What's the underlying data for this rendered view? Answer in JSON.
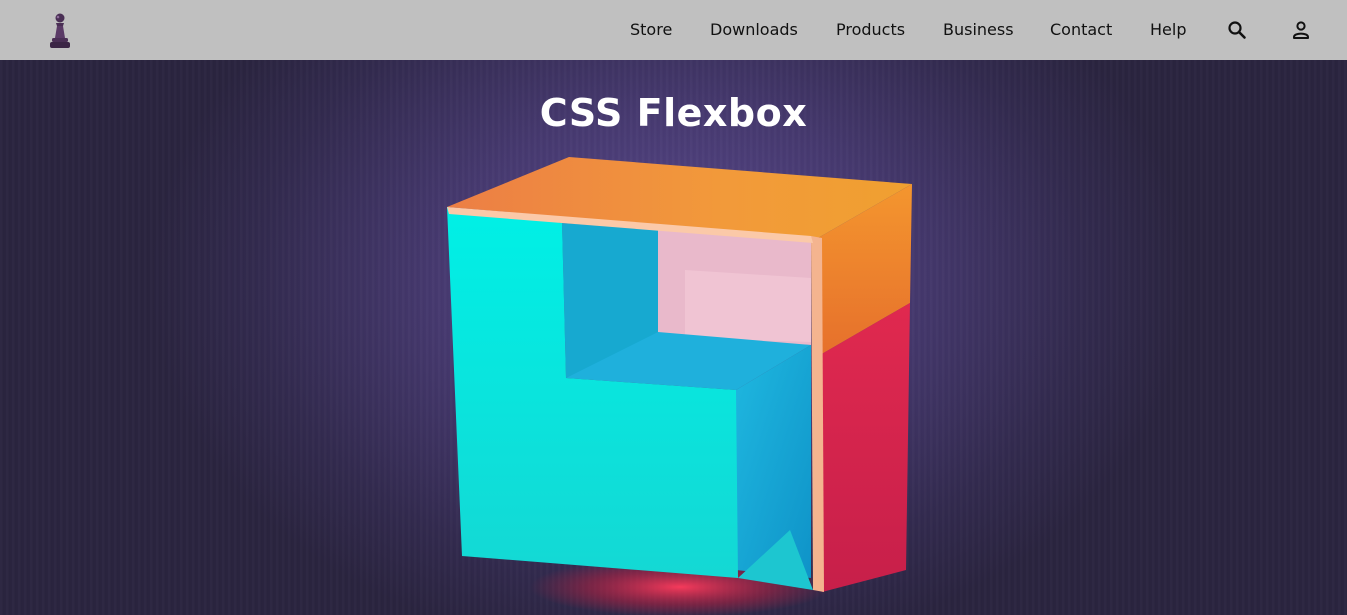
{
  "nav": {
    "links": [
      {
        "label": "Store"
      },
      {
        "label": "Downloads"
      },
      {
        "label": "Products"
      },
      {
        "label": "Business"
      },
      {
        "label": "Contact"
      },
      {
        "label": "Help"
      }
    ],
    "icons": {
      "search": "search-icon",
      "account": "user-icon",
      "logo": "pawn-logo-icon"
    }
  },
  "hero": {
    "title": "CSS Flexbox"
  },
  "colors": {
    "navbar": "#c0c0c0",
    "hero_bg": "#46396f",
    "cyan": "#00e5dd",
    "orange": "#f0902f",
    "red": "#d7264f",
    "pink": "#e8b3c7"
  }
}
